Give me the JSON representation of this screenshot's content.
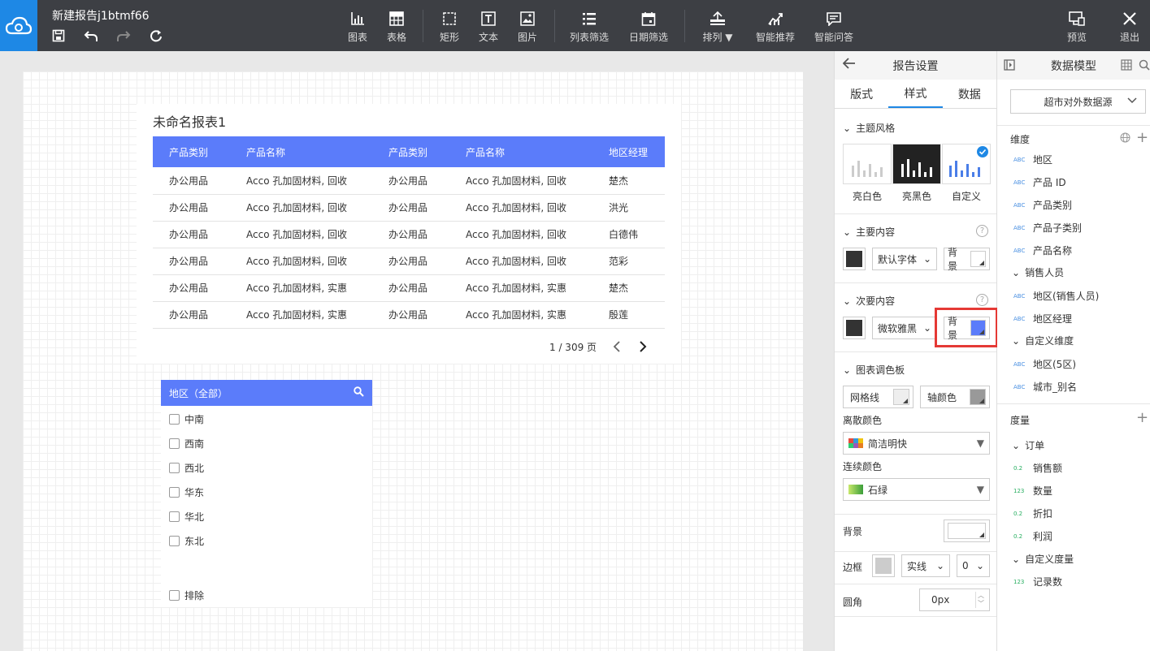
{
  "app": {
    "doc_title": "新建报告j1btmf66"
  },
  "toolbar": {
    "chart": "图表",
    "table": "表格",
    "rect": "矩形",
    "text": "文本",
    "image": "图片",
    "list_filter": "列表筛选",
    "date_filter": "日期筛选",
    "arrange": "排列",
    "smart_recommend": "智能推荐",
    "smart_qa": "智能问答",
    "preview": "预览",
    "exit": "退出"
  },
  "report": {
    "title": "未命名报表1",
    "headers": [
      "产品类别",
      "产品名称",
      "产品类别",
      "产品名称",
      "地区经理"
    ],
    "rows": [
      [
        "办公用品",
        "Acco 孔加固材料, 回收",
        "办公用品",
        "Acco 孔加固材料, 回收",
        "楚杰"
      ],
      [
        "办公用品",
        "Acco 孔加固材料, 回收",
        "办公用品",
        "Acco 孔加固材料, 回收",
        "洪光"
      ],
      [
        "办公用品",
        "Acco 孔加固材料, 回收",
        "办公用品",
        "Acco 孔加固材料, 回收",
        "白德伟"
      ],
      [
        "办公用品",
        "Acco 孔加固材料, 回收",
        "办公用品",
        "Acco 孔加固材料, 回收",
        "范彩"
      ],
      [
        "办公用品",
        "Acco 孔加固材料, 实惠",
        "办公用品",
        "Acco 孔加固材料, 实惠",
        "楚杰"
      ],
      [
        "办公用品",
        "Acco 孔加固材料, 实惠",
        "办公用品",
        "Acco 孔加固材料, 实惠",
        "殷莲"
      ]
    ],
    "pager": "1 / 309 页"
  },
  "filter": {
    "title": "地区（全部）",
    "items": [
      "中南",
      "西南",
      "西北",
      "华东",
      "华北",
      "东北"
    ],
    "exclude": "排除"
  },
  "settings": {
    "title": "报告设置",
    "tabs": [
      "版式",
      "样式",
      "数据"
    ],
    "theme_section": "主题风格",
    "themes": [
      "亮白色",
      "亮黑色",
      "自定义"
    ],
    "primary_section": "主要内容",
    "primary_font": "默认字体",
    "secondary_section": "次要内容",
    "secondary_font": "微软雅黑",
    "bg_label": "背景",
    "palette_section": "图表调色板",
    "gridline": "网格线",
    "axis_color": "轴颜色",
    "discrete_label": "离散颜色",
    "discrete_value": "简洁明快",
    "continuous_label": "连续颜色",
    "continuous_value": "石绿",
    "background_label": "背景",
    "border_label": "边框",
    "border_style": "实线",
    "border_width": "0",
    "radius_label": "圆角",
    "radius_value": "0px",
    "help": "?"
  },
  "colors": {
    "accent": "#5b7cfa",
    "topbar": "#3d3f44",
    "logo": "#1e88e5",
    "highlight": "#e53935"
  },
  "model": {
    "title": "数据模型",
    "datasource": "超市对外数据源",
    "dim_label": "维度",
    "dims": [
      {
        "type": "ABC",
        "name": "地区"
      },
      {
        "type": "ABC",
        "name": "产品 ID"
      },
      {
        "type": "ABC",
        "name": "产品类别"
      },
      {
        "type": "ABC",
        "name": "产品子类别"
      },
      {
        "type": "ABC",
        "name": "产品名称"
      }
    ],
    "group_sales": "销售人员",
    "sales_dims": [
      {
        "type": "ABC",
        "name": "地区(销售人员)"
      },
      {
        "type": "ABC",
        "name": "地区经理"
      }
    ],
    "group_custom_dim": "自定义维度",
    "custom_dims": [
      {
        "type": "ABC",
        "name": "地区(5区)"
      },
      {
        "type": "ABC",
        "name": "城市_别名"
      }
    ],
    "measure_label": "度量",
    "group_order": "订单",
    "measures": [
      {
        "type": "0.2",
        "name": "销售额"
      },
      {
        "type": "123",
        "name": "数量"
      },
      {
        "type": "0.2",
        "name": "折扣"
      },
      {
        "type": "0.2",
        "name": "利润"
      }
    ],
    "group_custom_measure": "自定义度量",
    "custom_measures": [
      {
        "type": "123",
        "name": "记录数"
      }
    ]
  }
}
